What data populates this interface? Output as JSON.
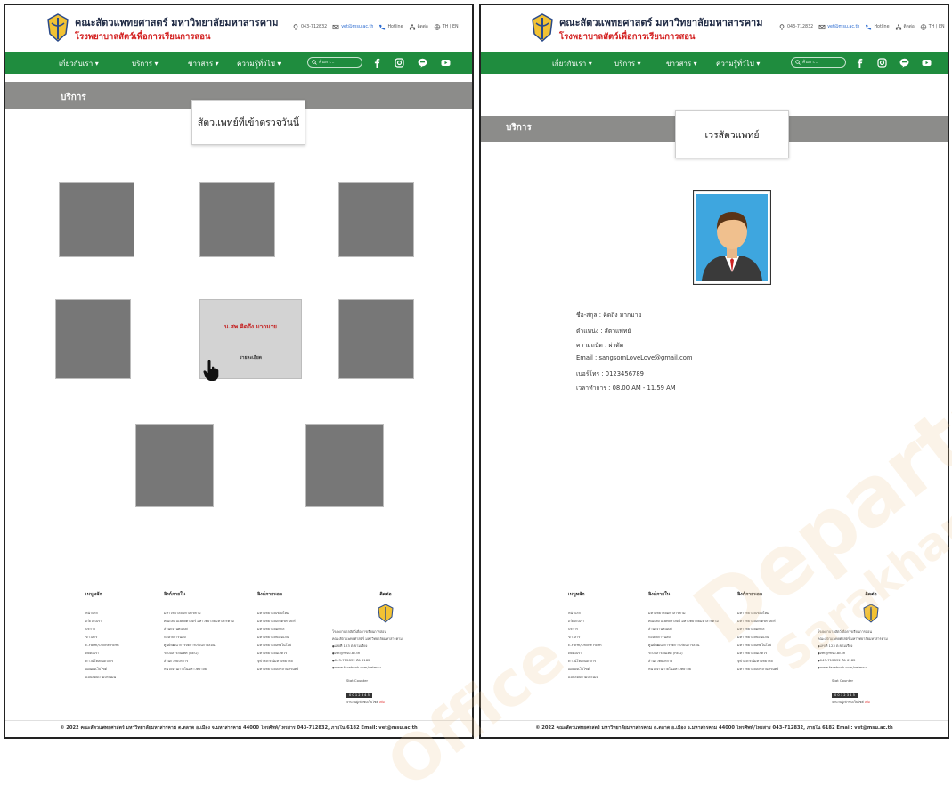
{
  "header": {
    "uni_name": "คณะสัตวแพทยศาสตร์ มหาวิทยาลัยมหาสารคาม",
    "hosp_name": "โรงพยาบาลสัตว์เพื่อการเรียนการสอน",
    "contacts": [
      {
        "icon": "location-pin-icon",
        "text": "043-712832"
      },
      {
        "icon": "mail-icon",
        "text": "vet@msu.ac.th"
      },
      {
        "icon": "phone-icon",
        "text": "Hotline"
      },
      {
        "icon": "sitemap-icon",
        "text": "ติดต่อ"
      },
      {
        "icon": "globe-icon",
        "text": "TH | EN"
      }
    ]
  },
  "nav": {
    "items": [
      "เกี่ยวกับเรา ▾",
      "บริการ ▾",
      "ข่าวสาร ▾",
      "ความรู้ทั่วไป ▾"
    ],
    "search_placeholder": "ค้นหา...",
    "social_icons": [
      "facebook-icon",
      "instagram-icon",
      "line-icon",
      "youtube-icon"
    ]
  },
  "colors": {
    "nav_green": "#1f8c3e",
    "banner_gray": "#8c8c8a",
    "accent_red": "#d32020"
  },
  "panel1": {
    "banner_title": "บริการ",
    "popup_title": "สัตวแพทย์ที่เข้าตรวจวันนี้",
    "highlight_card": {
      "name": "น.สพ คิดถึง มากมาย",
      "detail": "รายละเอียด"
    }
  },
  "panel2": {
    "banner_title": "บริการ",
    "popup_title": "เวรสัตวแพทย์",
    "info": [
      "ชื่อ-สกุล : คิดถึง มากมาย",
      "ตำแหน่ง : สัตวแพทย์",
      "ความถนัด : ผ่าตัด",
      "Email : sangsomLoveLove@gmail.com",
      "เบอร์โทร : 0123456789",
      "เวลาทำการ : 08.00 AM - 11.59 AM"
    ]
  },
  "footer": {
    "col1": {
      "title": "เมนูหลัก",
      "items": [
        "หน้าแรก",
        "เกี่ยวกับเรา",
        "บริการ",
        "ข่าวสาร",
        "E-Form/Online Form",
        "ติดต่อเรา",
        "ดาวน์โหลดเอกสาร",
        "แผนผังเว็บไซต์",
        "แบบสอบถามประเมิน"
      ]
    },
    "col2": {
      "title": "ลิงก์ภายใน",
      "items": [
        "มหาวิทยาลัยมหาสารคาม",
        "คณะสัตวแพทยศาสตร์ มหาวิทยาลัยมหาสารคาม",
        "สำนักงานคณบดี",
        "กองกิจการนิสิต",
        "ศูนย์พัฒนาการจัดการเรียนการสอน",
        "ระบบสารสนเทศ (REG)",
        "สำนักวิทยบริการ",
        "หน่วยงานภายในมหาวิทยาลัย"
      ]
    },
    "col3": {
      "title": "ลิงก์ภายนอก",
      "items": [
        "มหาวิทยาลัยเชียงใหม่",
        "มหาวิทยาลัยเกษตรศาสตร์",
        "มหาวิทยาลัยมหิดล",
        "มหาวิทยาลัยขอนแก่น",
        "มหาวิทยาลัยเทคโนโลยี",
        "มหาวิทยาลัยนเรศวร",
        "จุฬาลงกรณ์มหาวิทยาลัย",
        "มหาวิทยาลัยสงขลานครินทร์"
      ]
    },
    "col4": {
      "title": "ติดต่อ",
      "lines": [
        "โรงพยาบาลสัตว์เพื่อการเรียนการสอน",
        "คณะสัตวแพทยศาสตร์ มหาวิทยาลัยมหาสารคาม"
      ],
      "bullets": [
        "เลขที่ 123 ต.ขามเรียง",
        "vet@msu.ac.th",
        "043-712832 ต่อ 6182",
        "www.facebook.com/vetmsu"
      ],
      "counter_label": "Stat Counter",
      "counter_value": "0 0 1 2 3 4 5",
      "counter_note": "จำนวนผู้เข้าชมเว็บไซต์",
      "counter_link": "เพิ่ม"
    },
    "copyright": "© 2022 คณะสัตวแพทยศาสตร์ มหาวิทยาลัยมหาสารคาม ต.ตลาด อ.เมือง จ.มหาสารคาม 44000 โทรศัพท์/โทรสาร 043-712832, ภายใน 6182 Email: vet@msu.ac.th"
  },
  "watermark": [
    "Department",
    "Sarakham University",
    "Office"
  ]
}
